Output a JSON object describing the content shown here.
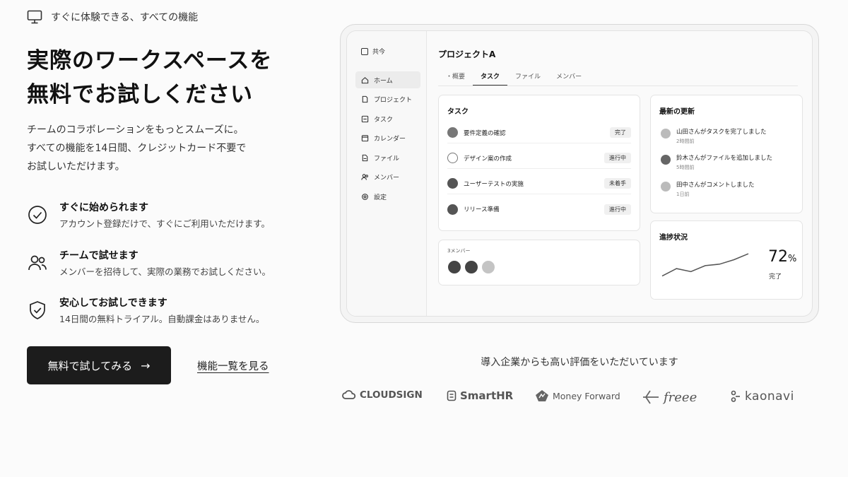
{
  "eyebrow": {
    "text": "すぐに体験できる、すべての機能",
    "icon": "monitor-icon"
  },
  "hero": {
    "title_line1": "実際のワークスペースを",
    "title_line2": "無料でお試しください",
    "desc_line1": "チームのコラボレーションをもっとスムーズに。",
    "desc_line2": "すべての機能を14日間、クレジットカード不要で",
    "desc_line3": "お試しいただけます。"
  },
  "features": [
    {
      "icon": "check-circle-icon",
      "title": "すぐに始められます",
      "desc": "アカウント登録だけで、すぐにご利用いただけます。"
    },
    {
      "icon": "users-icon",
      "title": "チームで試せます",
      "desc": "メンバーを招待して、実際の業務でお試しください。"
    },
    {
      "icon": "shield-check-icon",
      "title": "安心してお試しできます",
      "desc": "14日間の無料トライアル。自動課金はありません。"
    }
  ],
  "cta": {
    "label": "無料で試してみる",
    "arrow": "→"
  },
  "link": {
    "label": "機能一覧を見る"
  },
  "mock": {
    "brand": "共今",
    "nav": [
      {
        "label": "ホーム",
        "icon": "home-icon",
        "active": true
      },
      {
        "label": "プロジェクト",
        "icon": "document-icon",
        "active": false
      },
      {
        "label": "タスク",
        "icon": "task-icon",
        "active": false
      },
      {
        "label": "カレンダー",
        "icon": "calendar-icon",
        "active": false
      },
      {
        "label": "ファイル",
        "icon": "file-icon",
        "active": false
      },
      {
        "label": "メンバー",
        "icon": "members-icon",
        "active": false
      },
      {
        "label": "設定",
        "icon": "gear-icon",
        "active": false
      }
    ],
    "project_title": "プロジェクトA",
    "tabs": [
      "概要",
      "タスク",
      "ファイル",
      "メンバー"
    ],
    "active_tab": 1,
    "tasks_card": {
      "title": "タスク",
      "rows": [
        {
          "name": "要件定義の確認",
          "status": "完了"
        },
        {
          "name": "デザイン案の作成",
          "status": "進行中"
        },
        {
          "name": "ユーザーテストの実施",
          "status": "未着手"
        },
        {
          "name": "リリース準備",
          "status": "進行中"
        }
      ]
    },
    "updates_card": {
      "title": "最新の更新",
      "rows": [
        {
          "text": "山田さんがタスクを完了しました",
          "time": "2時間前"
        },
        {
          "text": "鈴木さんがファイルを追加しました",
          "time": "5時間前"
        },
        {
          "text": "田中さんがコメントしました",
          "time": "1日前"
        }
      ]
    },
    "members_card": {
      "label": "3メンバー"
    },
    "progress_card": {
      "title": "進捗状況",
      "value": "72",
      "unit": "%",
      "sub": "完了",
      "trend": [
        0.2,
        0.45,
        0.35,
        0.55,
        0.6,
        0.75,
        0.95
      ]
    }
  },
  "trust": {
    "heading": "導入企業からも高い評価をいただいています",
    "logos": [
      "CLOUDSIGN",
      "SmartHR",
      "Money Forward",
      "freee",
      "kaonavi"
    ]
  }
}
